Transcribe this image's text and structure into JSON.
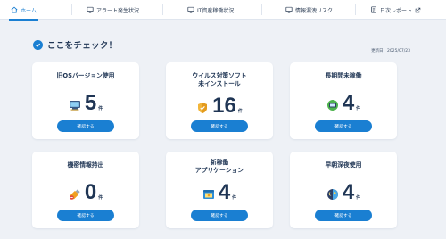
{
  "nav": {
    "items": [
      {
        "label": "ホーム",
        "icon": "home-icon",
        "active": true
      },
      {
        "label": "アラート発生状況",
        "icon": "monitor-icon",
        "active": false
      },
      {
        "label": "IT資産稼働状況",
        "icon": "monitor-icon",
        "active": false
      },
      {
        "label": "情報漏洩リスク",
        "icon": "monitor-icon",
        "active": false
      },
      {
        "label": "日次レポート",
        "icon": "external-link-icon",
        "active": false
      }
    ]
  },
  "heading": {
    "title": "ここをチェック！",
    "updated": "更新日：2025/07/23"
  },
  "cards": [
    {
      "title_line1": "旧OSバージョン使用",
      "title_line2": "",
      "count": "5",
      "unit": "件",
      "button": "確認する",
      "icon": "computer-icon"
    },
    {
      "title_line1": "ウイルス対策ソフト",
      "title_line2": "未インストール",
      "count": "16",
      "unit": "件",
      "button": "確認する",
      "icon": "shield-icon"
    },
    {
      "title_line1": "長期間未稼働",
      "title_line2": "",
      "count": "4",
      "unit": "件",
      "button": "確認する",
      "icon": "idle-device-icon"
    },
    {
      "title_line1": "機密情報持出",
      "title_line2": "",
      "count": "0",
      "unit": "件",
      "button": "確認する",
      "icon": "usb-icon"
    },
    {
      "title_line1": "新稼働",
      "title_line2": "アプリケーション",
      "count": "4",
      "unit": "件",
      "button": "確認する",
      "icon": "app-window-icon"
    },
    {
      "title_line1": "早朝深夜使用",
      "title_line2": "",
      "count": "4",
      "unit": "件",
      "button": "確認する",
      "icon": "day-night-icon"
    }
  ],
  "colors": {
    "accent": "#1a7fd2",
    "text": "#1f3554",
    "background": "#eef1f6"
  }
}
